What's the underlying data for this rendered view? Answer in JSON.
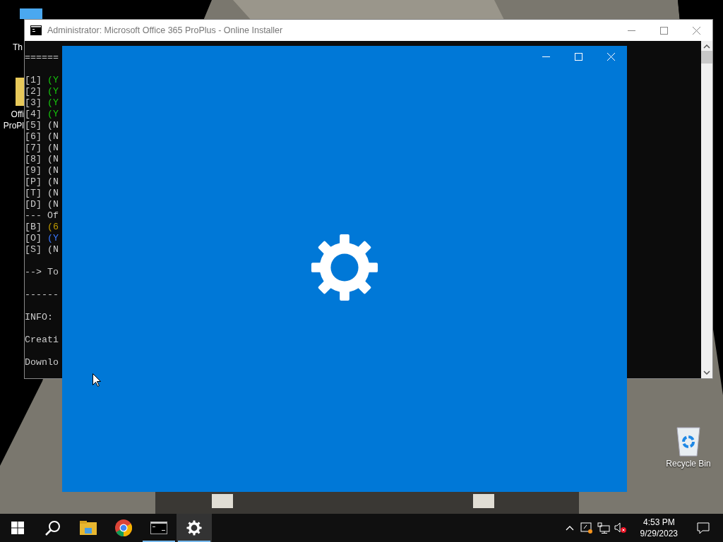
{
  "desktop_icons": [
    {
      "label": "Th",
      "kind": "pc"
    },
    {
      "label": "Offi\nProPl",
      "kind": "folder"
    },
    {
      "label": "Recycle Bin",
      "kind": "bin"
    }
  ],
  "console": {
    "title": "Administrator:  Microsoft Office 365 ProPlus - Online Installer",
    "blocks": [
      {
        "lines": [
          {
            "text": "======"
          }
        ]
      },
      {
        "lines": [
          {
            "text": "[1]",
            "tag": "(Y",
            "color": "#16c60c"
          },
          {
            "text": "[2]",
            "tag": "(Y",
            "color": "#16c60c"
          },
          {
            "text": "[3]",
            "tag": "(Y",
            "color": "#16c60c"
          },
          {
            "text": "[4]",
            "tag": "(Y",
            "color": "#16c60c"
          },
          {
            "text": "[5]",
            "tag": "(N"
          },
          {
            "text": "[6]",
            "tag": "(N"
          },
          {
            "text": "[7]",
            "tag": "(N"
          },
          {
            "text": "[8]",
            "tag": "(N"
          },
          {
            "text": "[9]",
            "tag": "(N"
          },
          {
            "text": "[P]",
            "tag": "(N"
          },
          {
            "text": "[T]",
            "tag": "(N"
          },
          {
            "text": "[D]",
            "tag": "(N"
          },
          {
            "text": "--- Of"
          },
          {
            "text": "[B]",
            "tag": "(6",
            "color": "#c19c00"
          },
          {
            "text": "[O]",
            "tag": "(Y",
            "color": "#3b78ff"
          },
          {
            "text": "[S]",
            "tag": "(N"
          }
        ]
      },
      {
        "lines": [
          {
            "text": "--> To"
          }
        ]
      },
      {
        "lines": [
          {
            "text": "------"
          }
        ]
      },
      {
        "lines": [
          {
            "text": "INFO:"
          }
        ]
      },
      {
        "lines": [
          {
            "text": "Creati"
          }
        ]
      },
      {
        "lines": [
          {
            "text": "Downlo"
          }
        ]
      }
    ]
  },
  "taskbar": {
    "apps": [
      {
        "kind": "start",
        "active": false
      },
      {
        "kind": "search",
        "active": false
      },
      {
        "kind": "explorer",
        "active": false
      },
      {
        "kind": "chrome",
        "active": false
      },
      {
        "kind": "console",
        "active": true
      },
      {
        "kind": "settings",
        "active": true,
        "selected": true
      }
    ],
    "clock": {
      "time": "4:53 PM",
      "date": "9/29/2023"
    }
  }
}
